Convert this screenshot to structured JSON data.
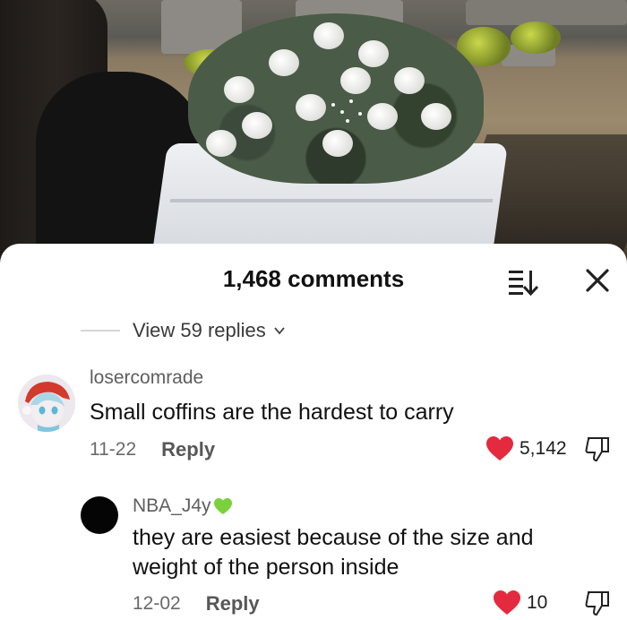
{
  "colors": {
    "heart": "#e32a3e",
    "text": "#111111",
    "muted": "#6a6a6a",
    "sheet": "#ffffff",
    "green_heart": "#7ad13c"
  },
  "header": {
    "comment_count": "1,468 comments"
  },
  "thread": {
    "view_replies_label": "View 59 replies"
  },
  "comments": [
    {
      "username": "losercomrade",
      "text": "Small coffins are the hardest to carry",
      "date": "11-22",
      "reply_label": "Reply",
      "likes": "5,142"
    },
    {
      "username": "NBA_J4y",
      "text": "they are easiest because of the size and weight of the person inside",
      "date": "12-02",
      "reply_label": "Reply",
      "likes": "10"
    }
  ],
  "icons": {
    "sort": "sort-icon",
    "close": "close-icon",
    "like": "heart-icon",
    "dislike": "thumbs-down-icon",
    "chevron": "chevron-down-icon",
    "name_suffix": "green-heart-icon"
  }
}
